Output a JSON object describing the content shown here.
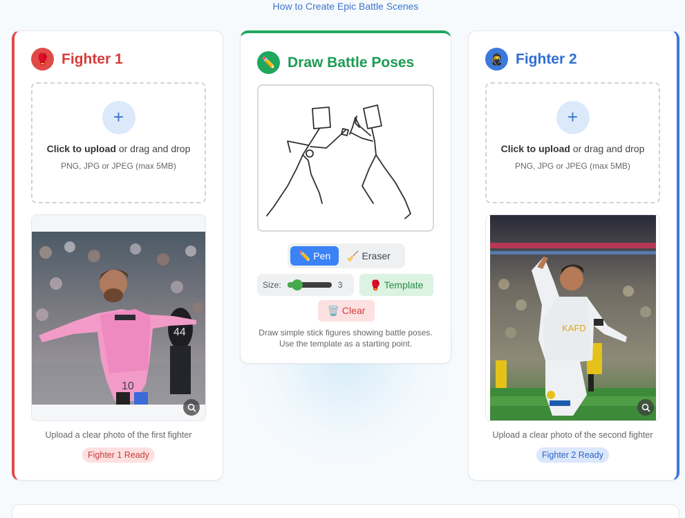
{
  "help_link": "How to Create Epic Battle Scenes",
  "fighter1": {
    "icon": "🥊",
    "title": "Fighter 1",
    "upload_action": "Click to upload",
    "upload_rest": "or drag and drop",
    "upload_formats": "PNG, JPG or JPEG (max 5MB)",
    "hint": "Upload a clear photo of the first fighter",
    "status": "Fighter 1 Ready",
    "accent": "#e04a48"
  },
  "draw": {
    "icon": "✏️",
    "title": "Draw Battle Poses",
    "tools": {
      "pen": "✏️ Pen",
      "eraser": "🧹 Eraser"
    },
    "size_label": "Size:",
    "size_value": "3",
    "template": "🥊 Template",
    "clear": "🗑️ Clear",
    "hint": "Draw simple stick figures showing battle poses. Use the template as a starting point.",
    "accent": "#1fa75d"
  },
  "fighter2": {
    "icon": "🥷",
    "title": "Fighter 2",
    "upload_action": "Click to upload",
    "upload_rest": "or drag and drop",
    "upload_formats": "PNG, JPG or JPEG (max 5MB)",
    "hint": "Upload a clear photo of the second fighter",
    "status": "Fighter 2 Ready",
    "accent": "#3a79dd"
  }
}
